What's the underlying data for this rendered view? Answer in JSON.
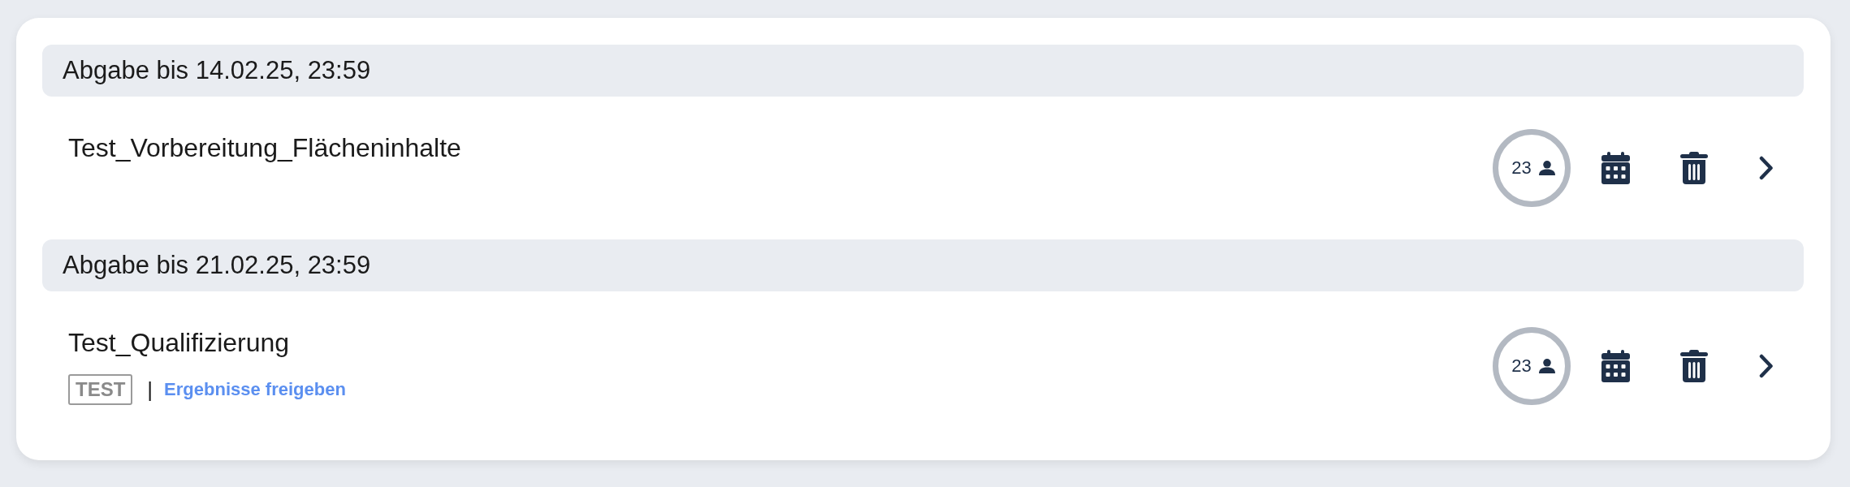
{
  "groups": [
    {
      "deadline": "Abgabe bis 14.02.25, 23:59",
      "items": [
        {
          "title": "Test_Vorbereitung_Flächeninhalte",
          "participants": "23"
        }
      ]
    },
    {
      "deadline": "Abgabe bis 21.02.25, 23:59",
      "items": [
        {
          "title": "Test_Qualifizierung",
          "tag": "TEST",
          "separator": "|",
          "action_link": "Ergebnisse freigeben",
          "participants": "23"
        }
      ]
    }
  ]
}
